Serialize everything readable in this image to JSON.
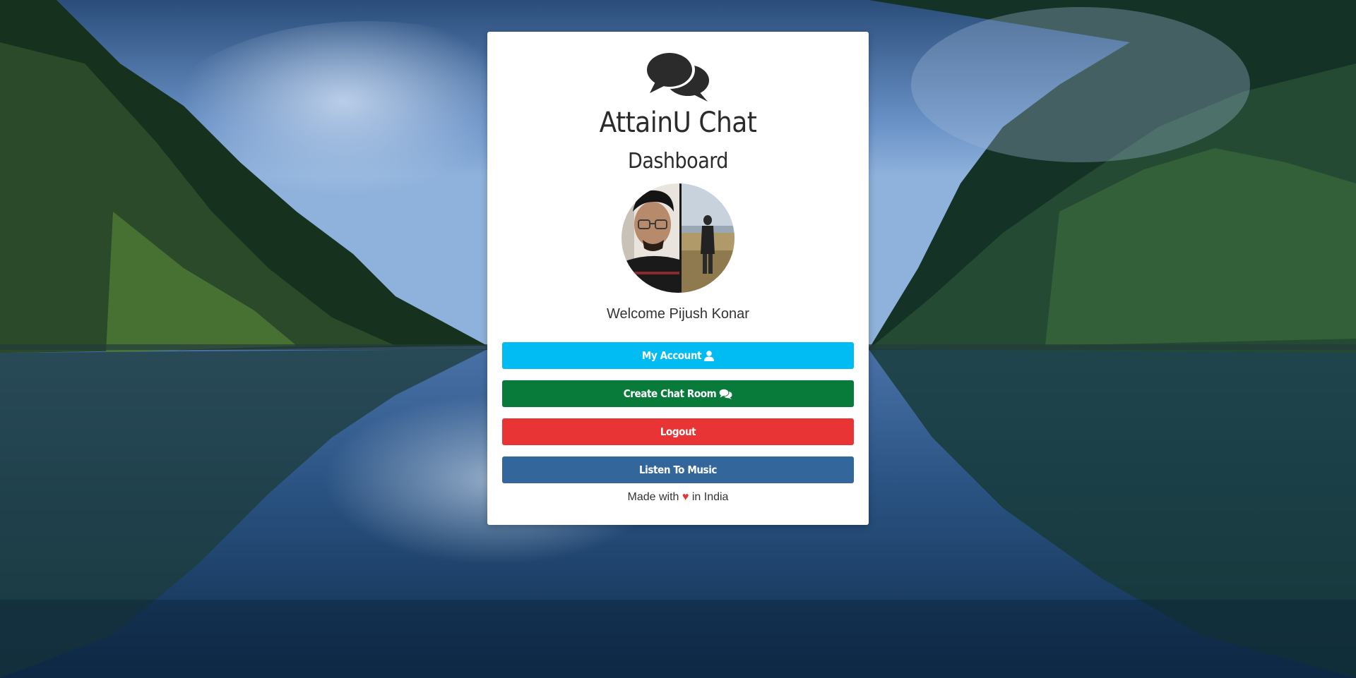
{
  "app": {
    "title": "AttainU Chat",
    "subtitle": "Dashboard"
  },
  "user": {
    "welcome_text": "Welcome Pijush Konar"
  },
  "actions": {
    "my_account_label": "My Account",
    "create_room_label": "Create Chat Room",
    "logout_label": "Logout",
    "music_label": "Listen To Music"
  },
  "footer": {
    "prefix": "Made with",
    "heart": "♥",
    "suffix": "in India"
  },
  "icons": {
    "logo": "comments-icon",
    "account": "user-icon",
    "room": "comments-icon"
  },
  "colors": {
    "my_account": "#00bcf2",
    "create_room": "#087a3a",
    "logout": "#e83434",
    "music": "#33679b",
    "heart": "#e83434"
  }
}
